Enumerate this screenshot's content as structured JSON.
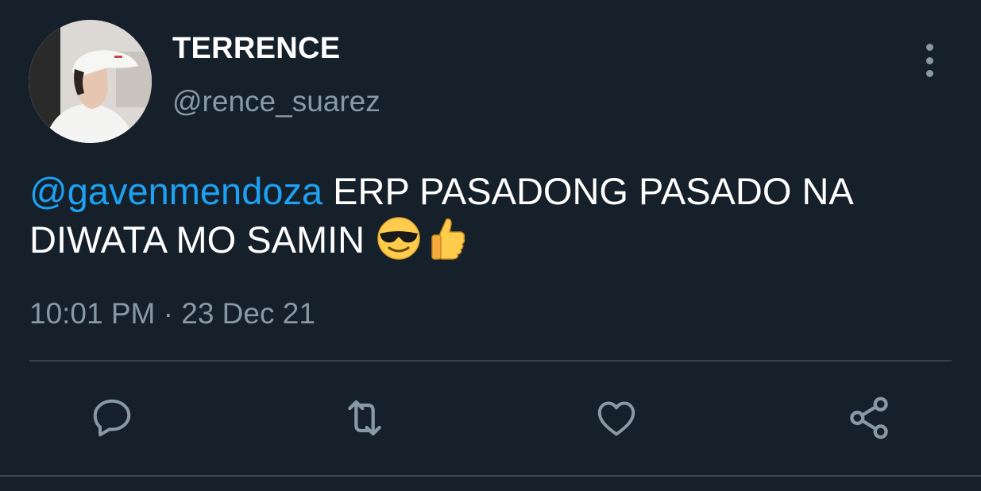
{
  "author": {
    "display_name": "TERRENCE",
    "handle": "@rence_suarez"
  },
  "tweet": {
    "mention": "@gavenmendoza",
    "text": " ERP PASADONG PASADO NA DIWATA MO SAMIN ",
    "emojis": [
      "smiling-face-with-sunglasses",
      "thumbs-up"
    ],
    "timestamp": "10:01 PM · 23 Dec 21"
  },
  "actions": [
    "reply-icon",
    "retweet-icon",
    "like-icon",
    "share-icon"
  ],
  "colors": {
    "background": "#15202b",
    "text": "#ffffff",
    "muted": "#8899a6",
    "mention": "#1da1f2",
    "divider": "#38444d"
  }
}
